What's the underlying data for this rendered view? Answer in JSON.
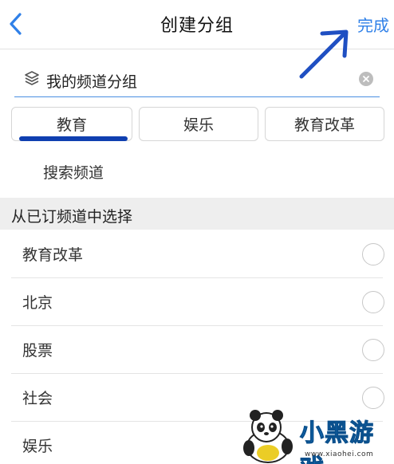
{
  "header": {
    "title": "创建分组",
    "done_label": "完成",
    "back_icon": "chevron-left-icon",
    "accent_color": "#2f80e8"
  },
  "group_name": {
    "value": "我的频道分组",
    "icon": "layers-icon"
  },
  "tabs": [
    {
      "label": "教育",
      "selected": true
    },
    {
      "label": "娱乐",
      "selected": false
    },
    {
      "label": "教育改革",
      "selected": false
    }
  ],
  "search_link": "搜索频道",
  "section": {
    "title": "从已订频道中选择"
  },
  "channels": [
    {
      "label": "教育改革",
      "checked": false
    },
    {
      "label": "北京",
      "checked": false
    },
    {
      "label": "股票",
      "checked": false
    },
    {
      "label": "社会",
      "checked": false
    },
    {
      "label": "娱乐",
      "checked": false
    }
  ],
  "watermark": {
    "brand": "小黑游戏",
    "url": "www.xiaohei.com"
  }
}
